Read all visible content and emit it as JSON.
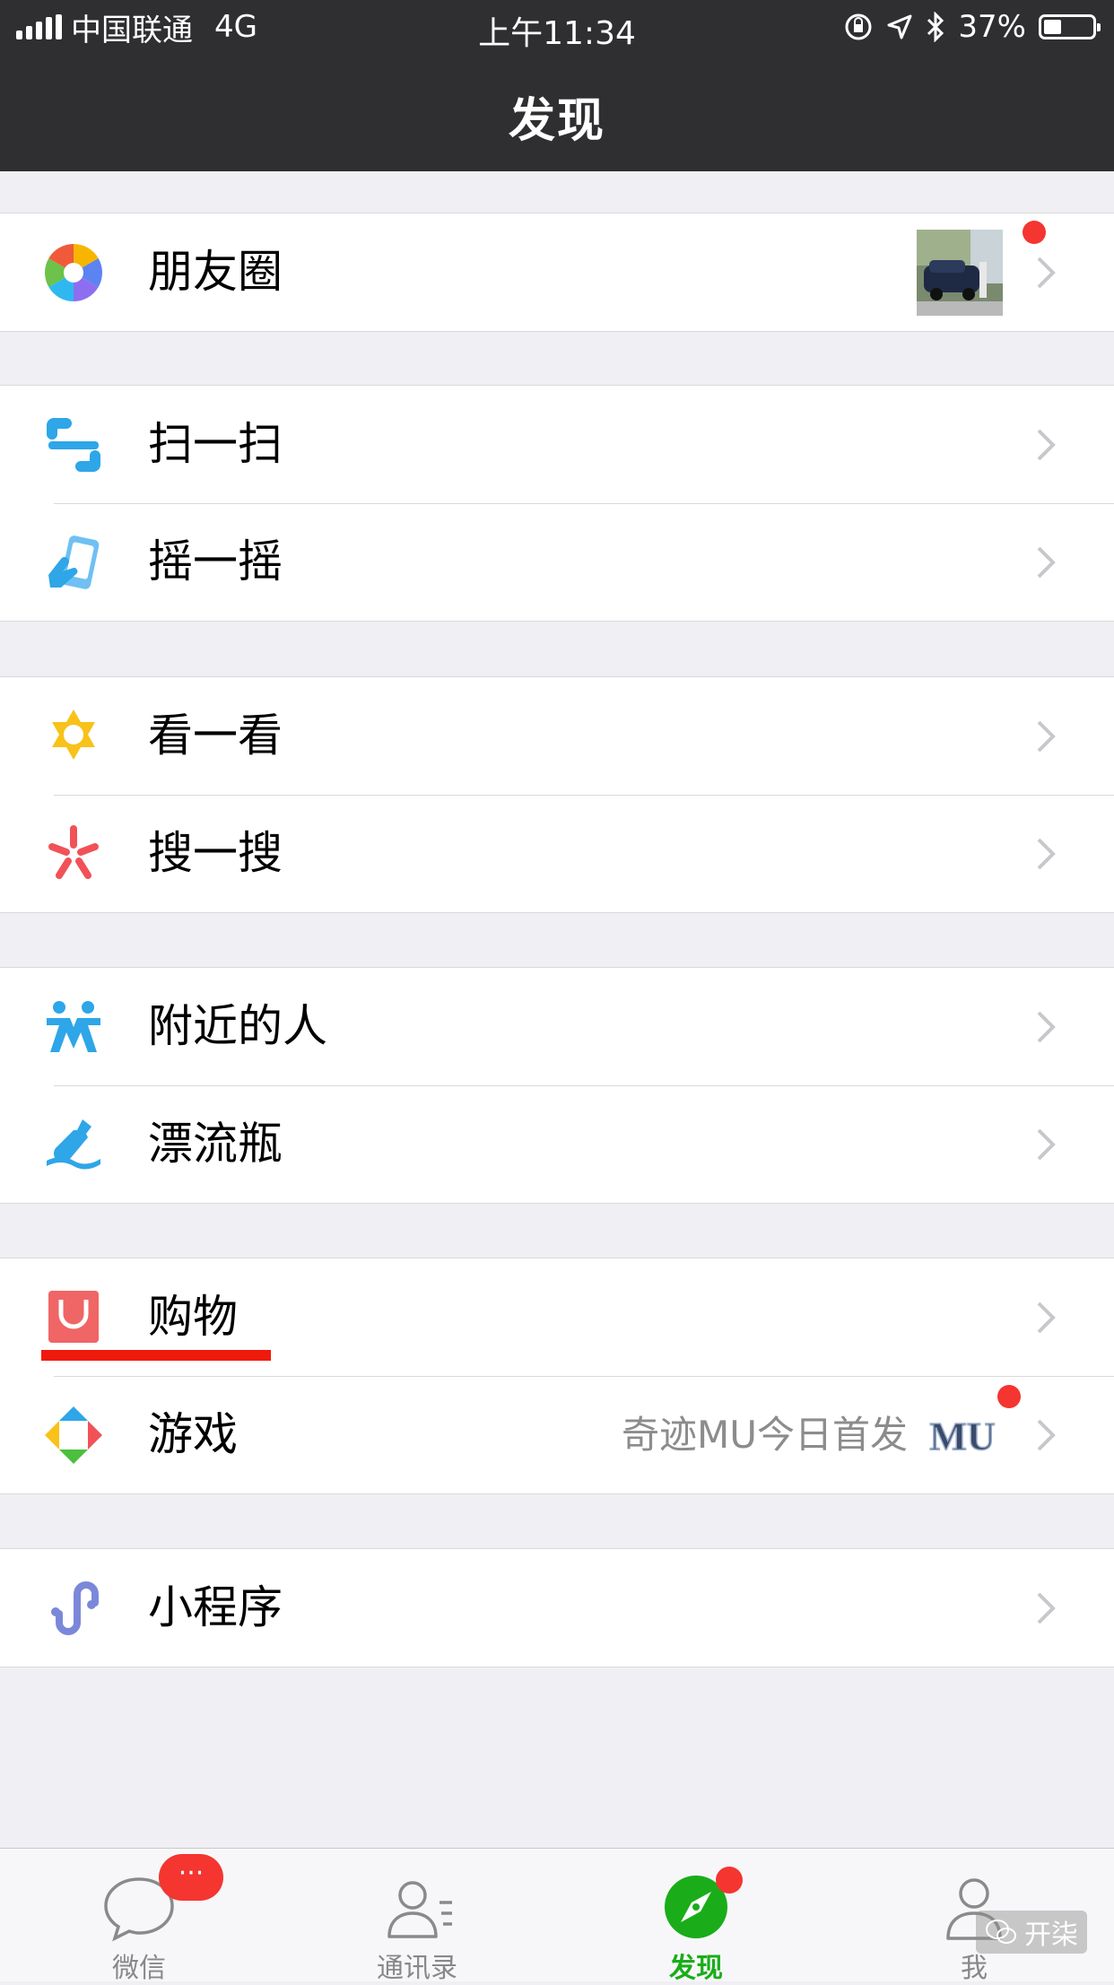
{
  "status_bar": {
    "carrier": "中国联通",
    "network": "4G",
    "time": "上午11:34",
    "battery": "37%",
    "battery_level": 0.37
  },
  "nav": {
    "title": "发现"
  },
  "groups": [
    {
      "items": [
        {
          "label": "朋友圈",
          "icon": "moments-aperture-icon",
          "has_thumbnail": true,
          "has_badge": true
        }
      ]
    },
    {
      "items": [
        {
          "label": "扫一扫",
          "icon": "scan-icon"
        },
        {
          "label": "摇一摇",
          "icon": "shake-phone-icon"
        }
      ]
    },
    {
      "items": [
        {
          "label": "看一看",
          "icon": "top-stories-icon"
        },
        {
          "label": "搜一搜",
          "icon": "search-burst-icon"
        }
      ]
    },
    {
      "items": [
        {
          "label": "附近的人",
          "icon": "people-nearby-icon"
        },
        {
          "label": "漂流瓶",
          "icon": "drift-bottle-icon"
        }
      ]
    },
    {
      "items": [
        {
          "label": "购物",
          "icon": "shopping-bag-icon"
        },
        {
          "label": "游戏",
          "icon": "games-icon",
          "subtitle": "奇迹MU今日首发",
          "has_badge": true,
          "promo_logo_text": "MU"
        }
      ]
    },
    {
      "items": [
        {
          "label": "小程序",
          "icon": "mini-programs-icon"
        }
      ]
    }
  ],
  "tab_bar": {
    "tabs": [
      {
        "label": "微信",
        "icon": "chat-bubble-icon",
        "badge": "···"
      },
      {
        "label": "通讯录",
        "icon": "contacts-icon"
      },
      {
        "label": "发现",
        "icon": "compass-icon",
        "active": true,
        "has_badge": true
      },
      {
        "label": "我",
        "icon": "me-person-icon"
      }
    ]
  },
  "watermark": {
    "text": "开柒"
  },
  "colors": {
    "nav_bg": "#2f2f32",
    "active_tab": "#1aad19",
    "badge": "#f43530",
    "annotation_underline": "#f01a0c"
  }
}
